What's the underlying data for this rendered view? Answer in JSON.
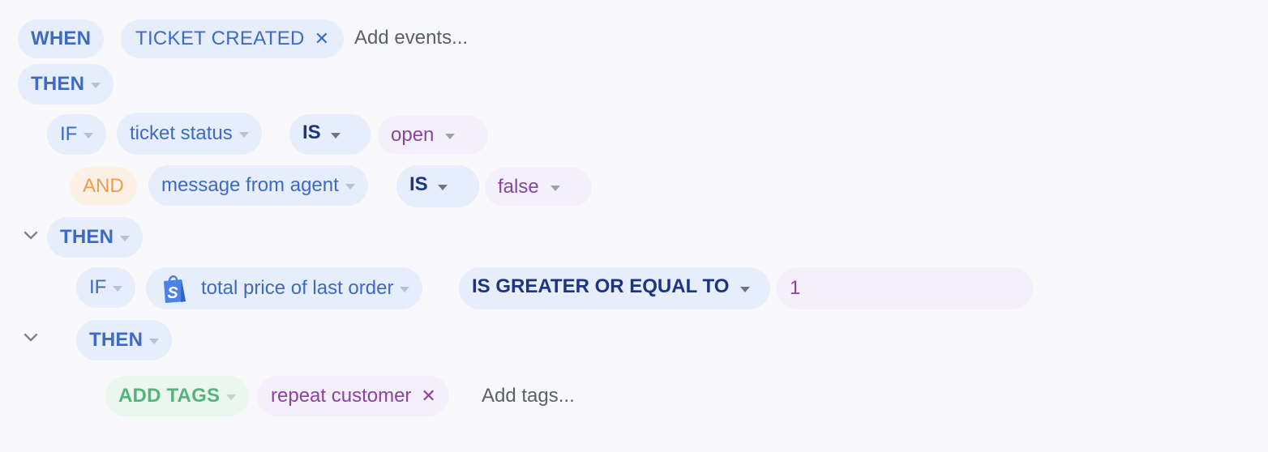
{
  "trigger": {
    "when_label": "WHEN",
    "event_tag": "TICKET CREATED",
    "add_events_placeholder": "Add events..."
  },
  "then1": {
    "label": "THEN"
  },
  "condition1": {
    "if_label": "IF",
    "field": "ticket status",
    "operator": "IS",
    "value": "open"
  },
  "condition2": {
    "and_label": "AND",
    "field": "message from agent",
    "operator": "IS",
    "value": "false"
  },
  "then2": {
    "label": "THEN"
  },
  "condition3": {
    "if_label": "IF",
    "field": "total price of last order",
    "operator": "IS GREATER OR EQUAL TO",
    "value": "1"
  },
  "then3": {
    "label": "THEN"
  },
  "action": {
    "label": "ADD TAGS",
    "tag": "repeat customer",
    "add_tags_placeholder": "Add tags..."
  },
  "icons": {
    "close": "close-icon",
    "caret": "caret-down-icon",
    "chevron": "chevron-down-icon",
    "shopify": "shopify-bag-icon"
  },
  "colors": {
    "background": "#f9f9fb",
    "blue_pill": "#e6edfb",
    "blue_text": "#3e6ac6",
    "navy_text": "#1d3481",
    "purple_text": "#8a42a3",
    "orange_text": "#ee9c4b",
    "green_text": "#55b47d"
  }
}
